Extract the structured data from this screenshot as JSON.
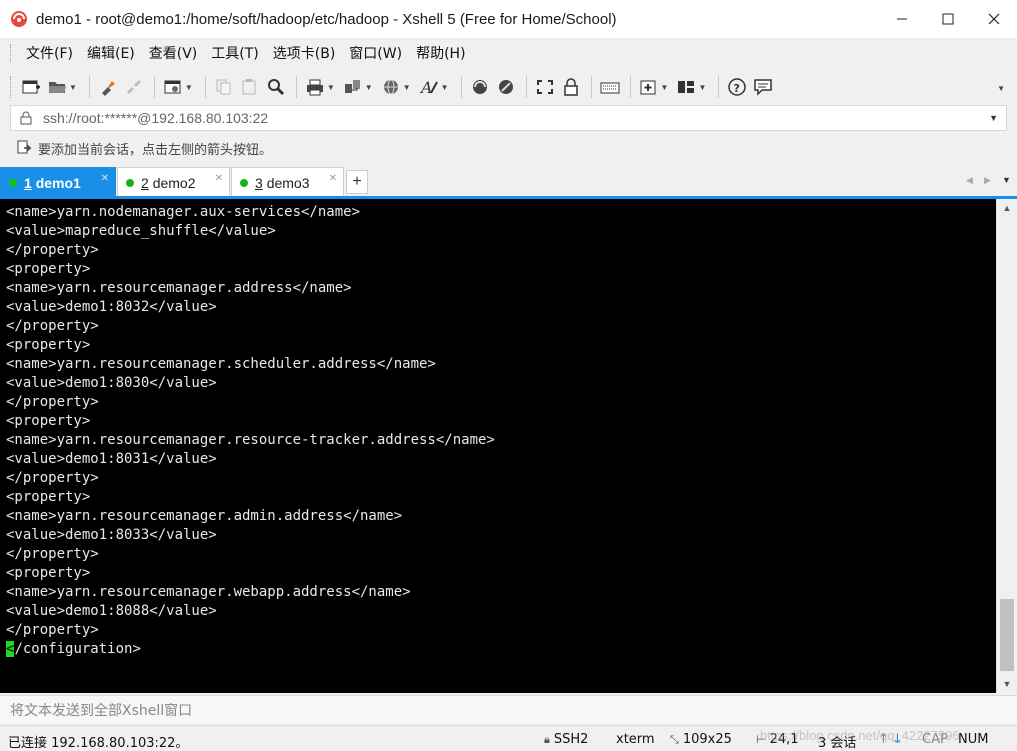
{
  "window": {
    "title": "demo1 - root@demo1:/home/soft/hadoop/etc/hadoop - Xshell 5 (Free for Home/School)",
    "minimize_glyph": "—",
    "maximize_glyph": "☐",
    "close_glyph": "✕"
  },
  "menu": {
    "items": [
      {
        "label": "文件(F)"
      },
      {
        "label": "编辑(E)"
      },
      {
        "label": "查看(V)"
      },
      {
        "label": "工具(T)"
      },
      {
        "label": "选项卡(B)"
      },
      {
        "label": "窗口(W)"
      },
      {
        "label": "帮助(H)"
      }
    ]
  },
  "toolbar": {
    "icons": [
      "new-session-icon",
      "open-folder-icon",
      "reconnect-icon",
      "disconnect-icon",
      "properties-icon",
      "copy-icon",
      "paste-icon",
      "find-icon",
      "print-icon",
      "transfer-icon",
      "globe-icon",
      "font-icon",
      "xftp-icon",
      "xmanager-icon",
      "fullscreen-icon",
      "lock-icon",
      "keyboard-icon",
      "add-tab-icon",
      "layout-icon",
      "help-icon",
      "chat-icon"
    ]
  },
  "address": {
    "value": "ssh://root:******@192.168.80.103:22"
  },
  "hint": {
    "text": "要添加当前会话，点击左侧的箭头按钮。"
  },
  "tabs": [
    {
      "number": "1",
      "name": "demo1",
      "active": true
    },
    {
      "number": "2",
      "name": "demo2",
      "active": false
    },
    {
      "number": "3",
      "name": "demo3",
      "active": false
    }
  ],
  "tab_add_glyph": "+",
  "terminal": {
    "lines": [
      "<name>yarn.nodemanager.aux-services</name>",
      "<value>mapreduce_shuffle</value>",
      "</property>",
      "<property>",
      "<name>yarn.resourcemanager.address</name>",
      "<value>demo1:8032</value>",
      "</property>",
      "<property>",
      "<name>yarn.resourcemanager.scheduler.address</name>",
      "<value>demo1:8030</value>",
      "</property>",
      "<property>",
      "<name>yarn.resourcemanager.resource-tracker.address</name>",
      "<value>demo1:8031</value>",
      "</property>",
      "<property>",
      "<name>yarn.resourcemanager.admin.address</name>",
      "<value>demo1:8033</value>",
      "</property>",
      "<property>",
      "<name>yarn.resourcemanager.webapp.address</name>",
      "<value>demo1:8088</value>",
      "</property>"
    ],
    "cursor_char": "<",
    "cursor_line_rest": "/configuration>"
  },
  "sendbar": {
    "placeholder": "将文本发送到全部Xshell窗口"
  },
  "status": {
    "connection": "已连接 192.168.80.103:22。",
    "protocol": "SSH2",
    "terminal_type": "xterm",
    "size": "109x25",
    "position": "24,1",
    "sessions": "3 会话",
    "caps": "CAP",
    "num": "NUM"
  },
  "watermark": {
    "text": "https://blog.csdn.net/qq_42227596"
  },
  "colors": {
    "accent": "#1a8fe8",
    "terminal_bg": "#000000",
    "terminal_fg": "#e8e8e8",
    "cursor": "#22d81e",
    "session_dot": "#17b21a"
  }
}
